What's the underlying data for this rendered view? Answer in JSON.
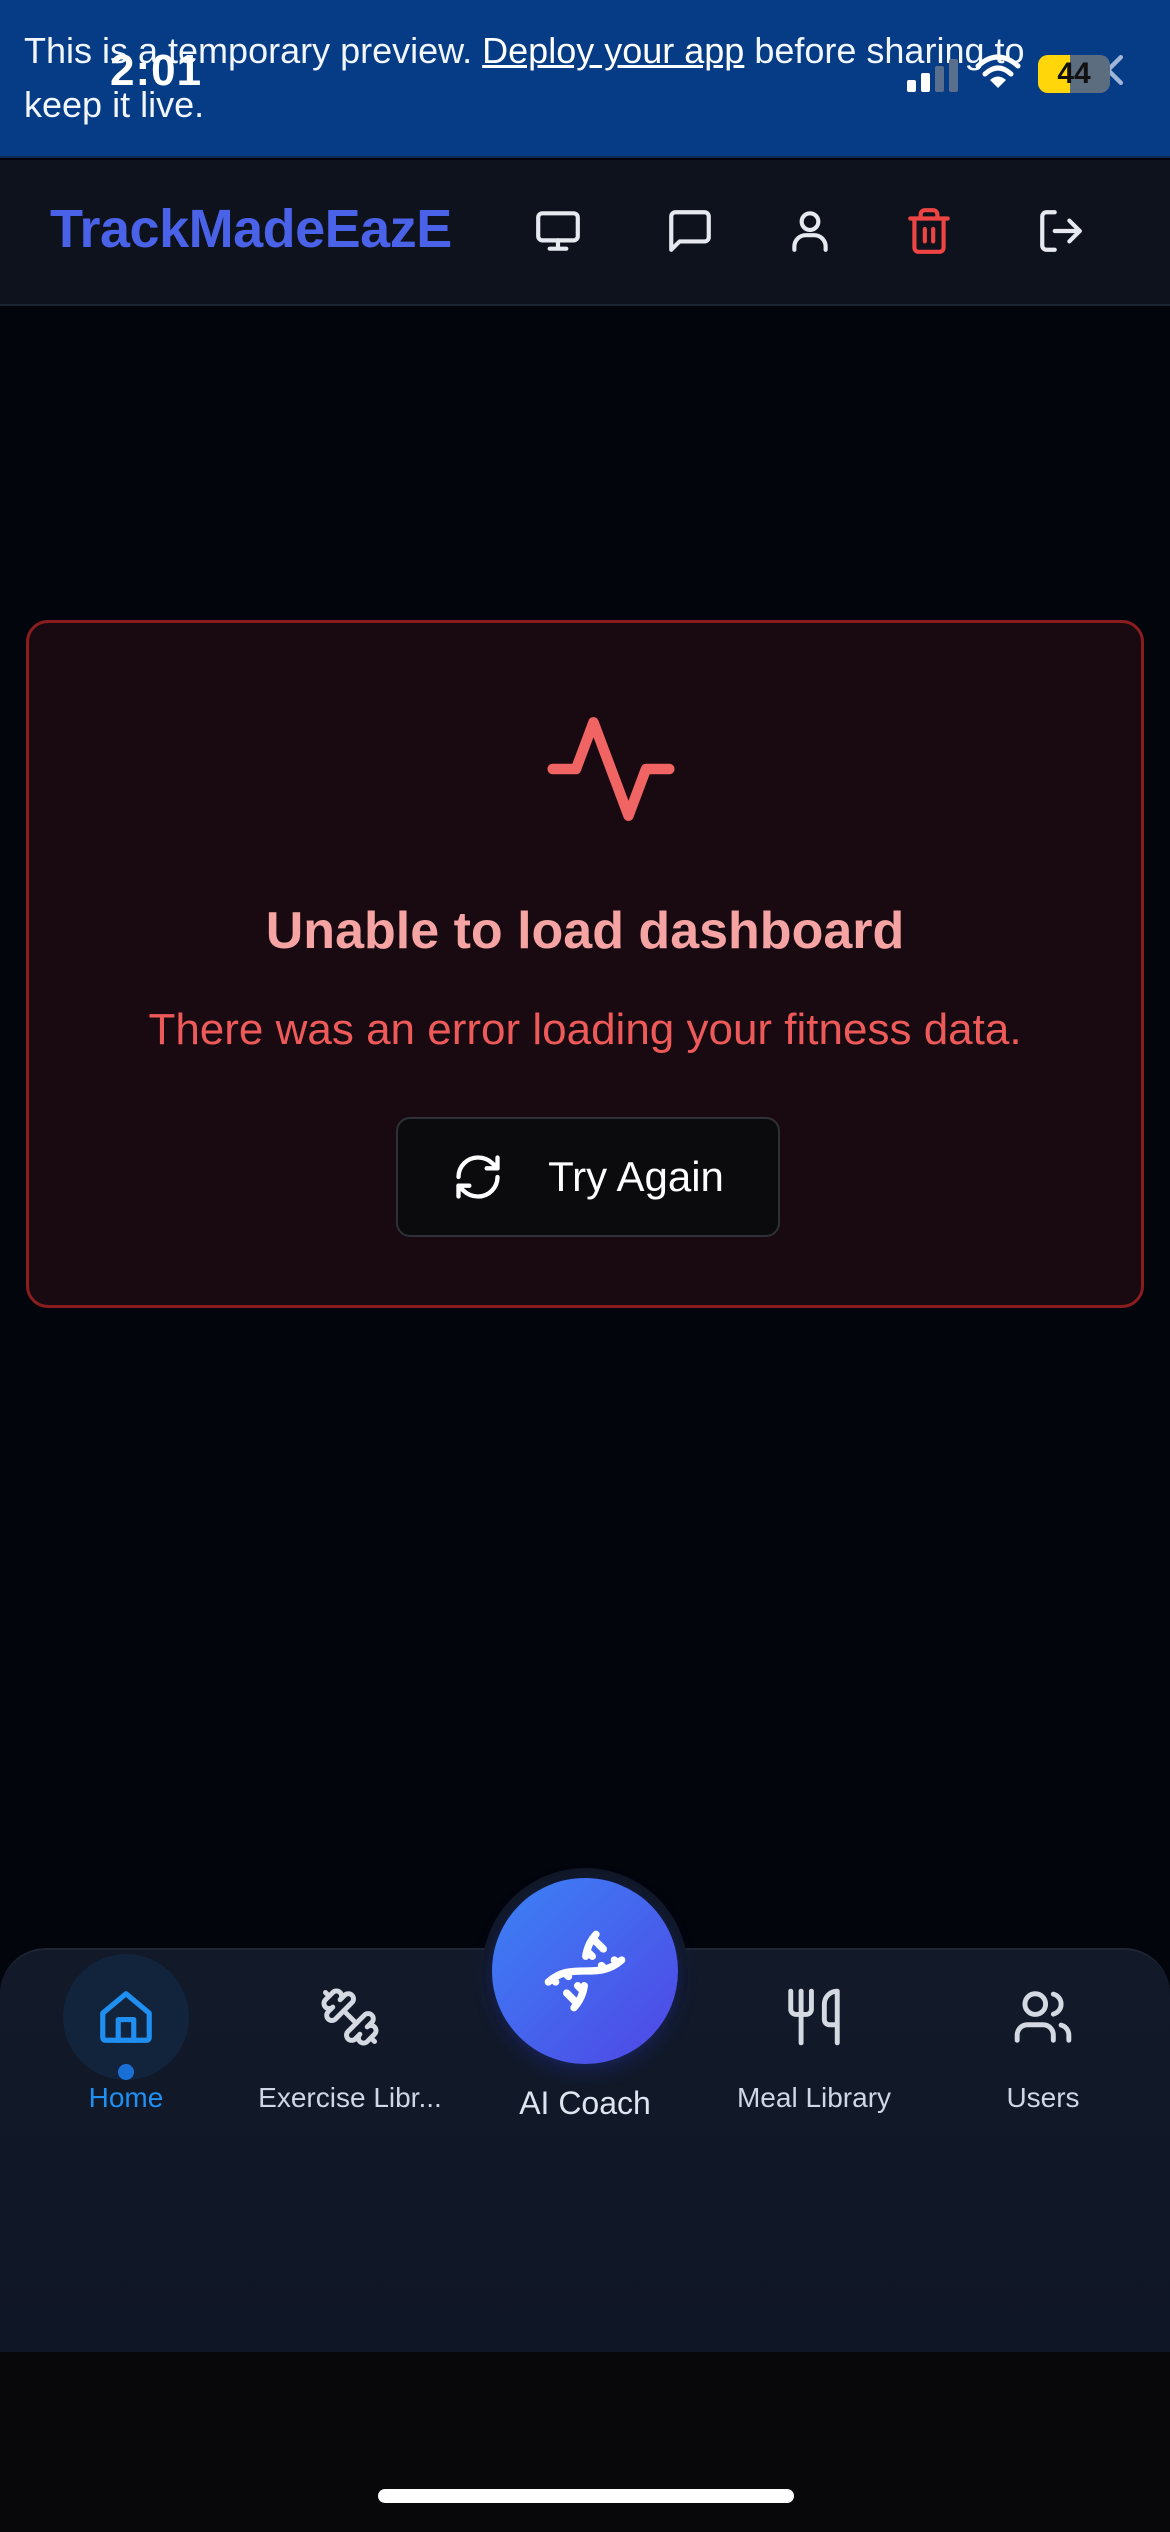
{
  "banner": {
    "text_before": "This is a temporary preview. ",
    "link_text": "Deploy your app",
    "text_after": " before sharing to keep it live."
  },
  "status_bar": {
    "time": "2:01",
    "battery_level": "44",
    "battery_fraction": 0.44
  },
  "header": {
    "brand": "TrackMadeEazE",
    "icons": [
      "monitor-icon",
      "message-icon",
      "user-icon",
      "trash-icon",
      "logout-icon"
    ],
    "danger_color": "#ef4444"
  },
  "error": {
    "icon": "activity-pulse-icon",
    "title": "Unable to load dashboard",
    "message": "There was an error loading your fitness data.",
    "retry_label": "Try Again",
    "accent_color": "#f06464"
  },
  "bottom_nav": {
    "items": [
      {
        "label": "Home",
        "icon": "home-icon",
        "active": true
      },
      {
        "label": "Exercise Libr...",
        "icon": "dumbbell-icon",
        "active": false
      },
      {
        "label": "Meal Library",
        "icon": "utensils-icon",
        "active": false
      },
      {
        "label": "Users",
        "icon": "users-icon",
        "active": false
      }
    ],
    "center": {
      "label": "AI Coach",
      "icon": "dna-icon"
    },
    "active_color": "#1f8ff2"
  }
}
